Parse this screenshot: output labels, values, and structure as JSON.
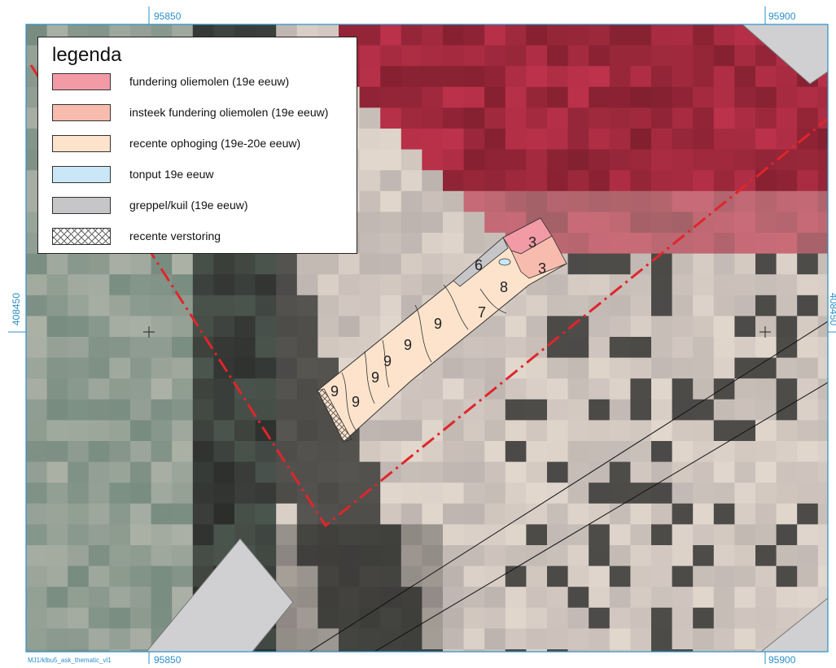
{
  "coordinates": {
    "top_left": "95850",
    "top_right": "95900",
    "bottom_left": "95850",
    "bottom_right": "95900",
    "left_side": "408450",
    "right_side": "408450"
  },
  "credit": "MJ1/klbu5_ask_thematic_vl1",
  "legend": {
    "title": "legenda",
    "items": [
      {
        "label": "fundering oliemolen (19e eeuw)",
        "color": "#f29aa6",
        "pattern": "solid"
      },
      {
        "label": "insteek fundering oliemolen (19e eeuw)",
        "color": "#f8bcae",
        "pattern": "solid"
      },
      {
        "label": "recente ophoging (19e-20e eeuw)",
        "color": "#fde3cc",
        "pattern": "solid"
      },
      {
        "label": "tonput 19e eeuw",
        "color": "#c9e7f7",
        "pattern": "solid"
      },
      {
        "label": "greppel/kuil (19e eeuw)",
        "color": "#c6c6c8",
        "pattern": "solid"
      },
      {
        "label": "recente verstoring",
        "color": "#ffffff",
        "pattern": "crosshatch"
      }
    ]
  },
  "features": {
    "labels": [
      "3",
      "3",
      "6",
      "8",
      "7",
      "9",
      "9",
      "9",
      "9",
      "9",
      "9"
    ]
  },
  "colors": {
    "frame": "#2a8fc8",
    "boundary_line": "#e0252b"
  }
}
